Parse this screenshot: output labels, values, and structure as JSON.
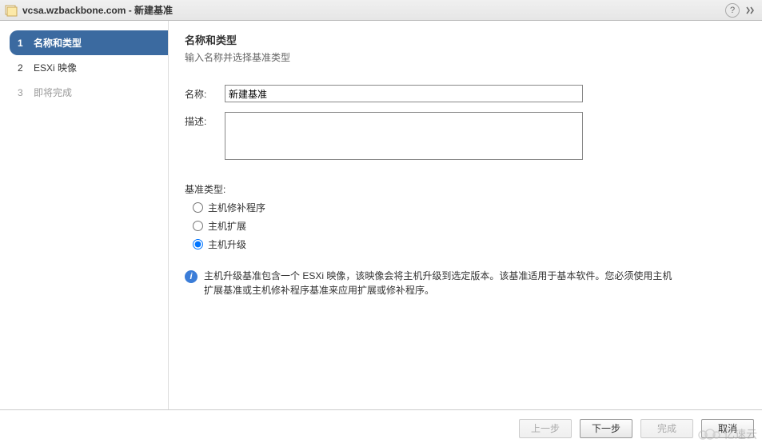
{
  "titlebar": {
    "title": "vcsa.wzbackbone.com - 新建基准"
  },
  "sidebar": {
    "steps": [
      {
        "num": "1",
        "label": "名称和类型",
        "state": "active"
      },
      {
        "num": "2",
        "label": "ESXi 映像",
        "state": "normal"
      },
      {
        "num": "3",
        "label": "即将完成",
        "state": "disabled"
      }
    ]
  },
  "content": {
    "heading": "名称和类型",
    "subtitle": "输入名称并选择基准类型",
    "name_label": "名称:",
    "name_value": "新建基准",
    "desc_label": "描述:",
    "desc_value": "",
    "type_label": "基准类型:",
    "radios": {
      "patch": "主机修补程序",
      "extension": "主机扩展",
      "upgrade": "主机升级"
    },
    "selected_radio": "upgrade",
    "info_text": "主机升级基准包含一个 ESXi 映像，该映像会将主机升级到选定版本。该基准适用于基本软件。您必须使用主机扩展基准或主机修补程序基准来应用扩展或修补程序。"
  },
  "footer": {
    "back": "上一步",
    "next": "下一步",
    "finish": "完成",
    "cancel": "取消"
  },
  "watermark": "亿速云"
}
